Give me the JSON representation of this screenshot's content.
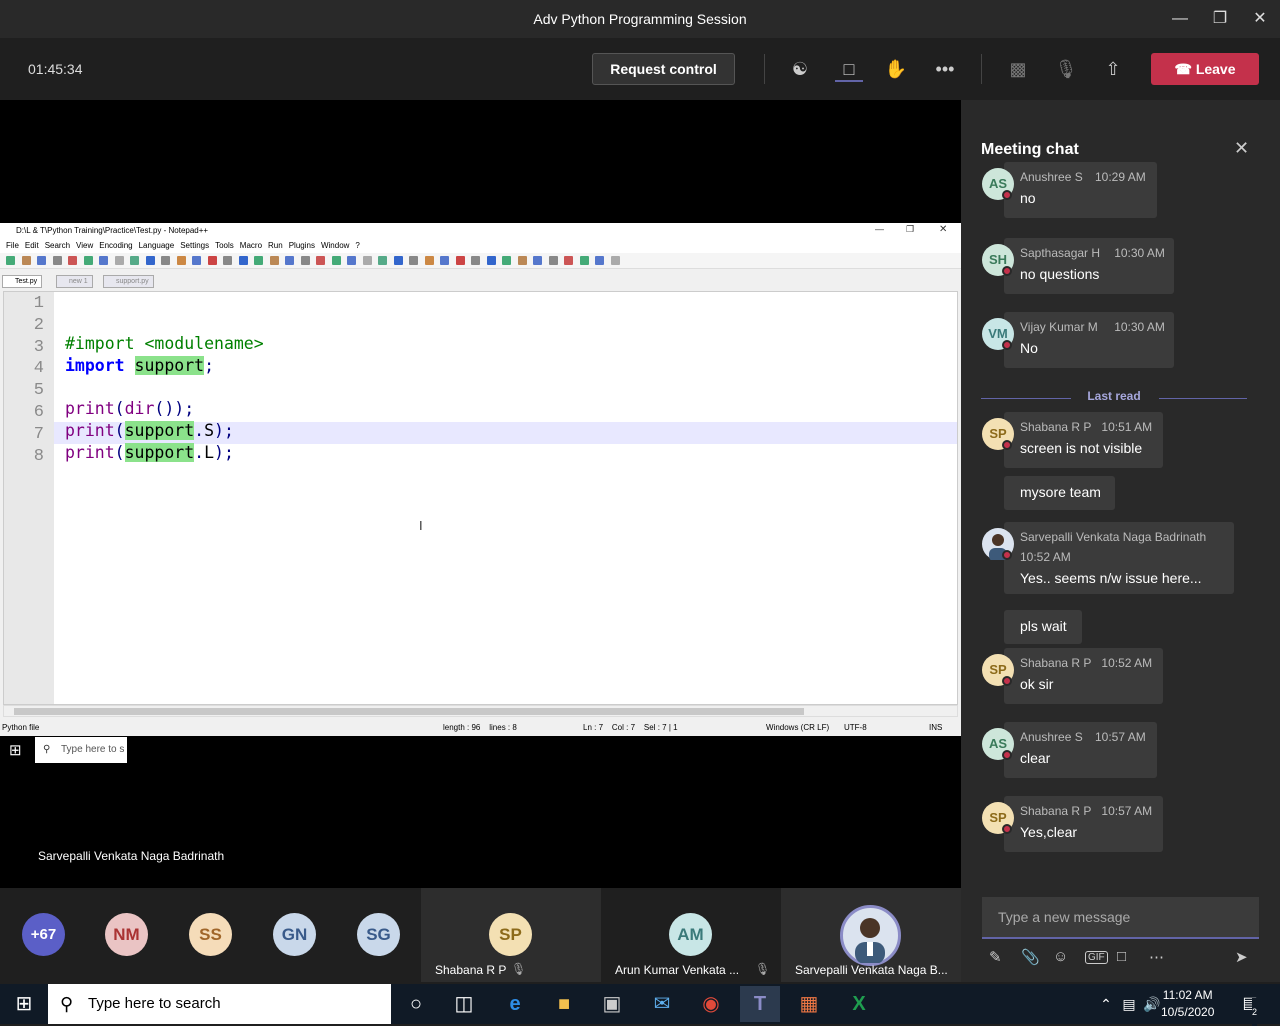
{
  "window": {
    "title": "Adv Python Programming Session"
  },
  "meeting": {
    "timer": "01:45:34",
    "request_control": "Request control",
    "leave": "Leave"
  },
  "notepad": {
    "title": "D:\\L & T\\Python Training\\Practice\\Test.py - Notepad++",
    "menu": [
      "File",
      "Edit",
      "Search",
      "View",
      "Encoding",
      "Language",
      "Settings",
      "Tools",
      "Macro",
      "Run",
      "Plugins",
      "Window",
      "?"
    ],
    "tabs": [
      "Test.py",
      "new 1",
      "support.py"
    ],
    "lines": [
      "",
      "#import <modulename>",
      "import support;",
      "",
      "print(dir());",
      "print(support.S);",
      "print(support.L);",
      ""
    ],
    "line_numbers": [
      "1",
      "2",
      "3",
      "4",
      "5",
      "6",
      "7",
      "8"
    ],
    "status": {
      "filetype": "Python file",
      "length": "length : 96    lines : 8",
      "pos": "Ln : 7    Col : 7    Sel : 7 | 1",
      "eol": "Windows (CR LF)",
      "enc": "UTF-8",
      "mode": "INS"
    },
    "win_search": "Type here to s"
  },
  "presenter": "Sarvepalli Venkata Naga Badrinath",
  "participants": {
    "overflow": "+67",
    "avatars": [
      "NM",
      "SS",
      "GN",
      "SG"
    ],
    "cards": [
      {
        "initials": "SP",
        "name": "Shabana R P"
      },
      {
        "initials": "AM",
        "name": "Arun Kumar Venkata ..."
      },
      {
        "initials": "",
        "name": "Sarvepalli Venkata Naga B..."
      }
    ]
  },
  "chat": {
    "title": "Meeting chat",
    "last_read": "Last read",
    "compose_placeholder": "Type a new message",
    "messages": [
      {
        "initials": "AS",
        "name": "Anushree S",
        "time": "10:29 AM",
        "text": "no"
      },
      {
        "initials": "SH",
        "name": "Sapthasagar H",
        "time": "10:30 AM",
        "text": "no questions"
      },
      {
        "initials": "VM",
        "name": "Vijay Kumar M",
        "time": "10:30 AM",
        "text": "No"
      },
      {
        "initials": "SP",
        "name": "Shabana R P",
        "time": "10:51 AM",
        "text": "screen is not visible",
        "extra": "mysore team"
      },
      {
        "initials": "",
        "name": "Sarvepalli Venkata Naga Badrinath",
        "time": "10:52 AM",
        "text": "Yes.. seems n/w issue here...",
        "extra": "pls wait"
      },
      {
        "initials": "SP",
        "name": "Shabana R P",
        "time": "10:52 AM",
        "text": "ok sir"
      },
      {
        "initials": "AS",
        "name": "Anushree S",
        "time": "10:57 AM",
        "text": "clear"
      },
      {
        "initials": "SP",
        "name": "Shabana R P",
        "time": "10:57 AM",
        "text": "Yes,clear"
      }
    ]
  },
  "taskbar": {
    "search": "Type here to search",
    "time": "11:02 AM",
    "date": "10/5/2020",
    "notifications": "2"
  },
  "colors": {
    "accent": "#6264a7",
    "leave": "#c4314b",
    "keyword": "#0000ff",
    "func": "#800080",
    "highlight": "#8be28b"
  }
}
